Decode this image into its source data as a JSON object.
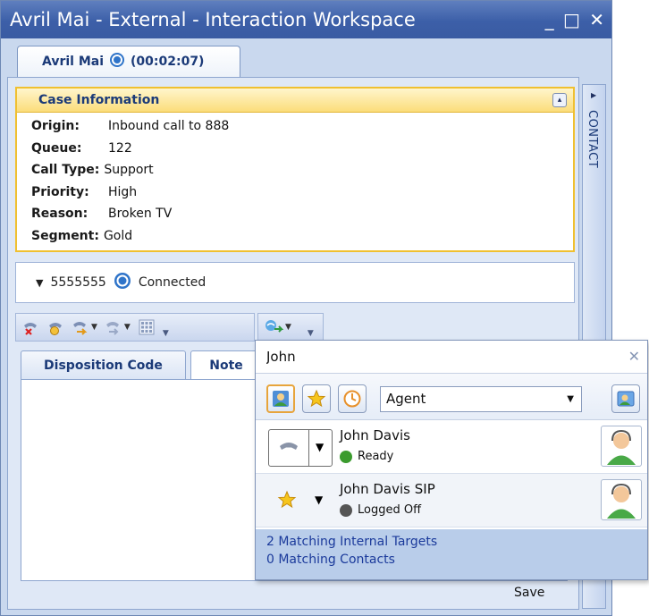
{
  "window": {
    "title": "Avril Mai - External - Interaction Workspace",
    "controls": "_ □ ✕"
  },
  "main_tab": {
    "name": "Avril Mai",
    "timer": "(00:02:07)"
  },
  "case_info": {
    "header": "Case Information",
    "collapse_glyph": "▴",
    "fields": [
      {
        "key": "Origin:",
        "value": "Inbound call to 888"
      },
      {
        "key": "Queue:",
        "value": "122"
      },
      {
        "key": "Call Type:",
        "value": "Support"
      },
      {
        "key": "Priority:",
        "value": "High"
      },
      {
        "key": "Reason:",
        "value": "Broken TV"
      },
      {
        "key": "Segment:",
        "value": "Gold"
      }
    ]
  },
  "call": {
    "number": "5555555",
    "status": "Connected"
  },
  "subtabs": {
    "disposition": "Disposition Code",
    "note": "Note"
  },
  "note_area": {
    "save_label": "Save"
  },
  "contact_panel": {
    "label": "CONTACT"
  },
  "team_search": {
    "query": "John",
    "filter_type": "Agent",
    "results": [
      {
        "name": "John Davis",
        "status": "Ready",
        "status_color": "#3b9b2e"
      },
      {
        "name": "John Davis SIP",
        "status": "Logged Off",
        "status_color": "#555555"
      }
    ],
    "summary_internal": "2 Matching Internal Targets",
    "summary_contacts": "0 Matching Contacts"
  },
  "colors": {
    "accent": "#3c5fa8",
    "case_border": "#f0c030",
    "summary_text": "#1b3a9b"
  }
}
